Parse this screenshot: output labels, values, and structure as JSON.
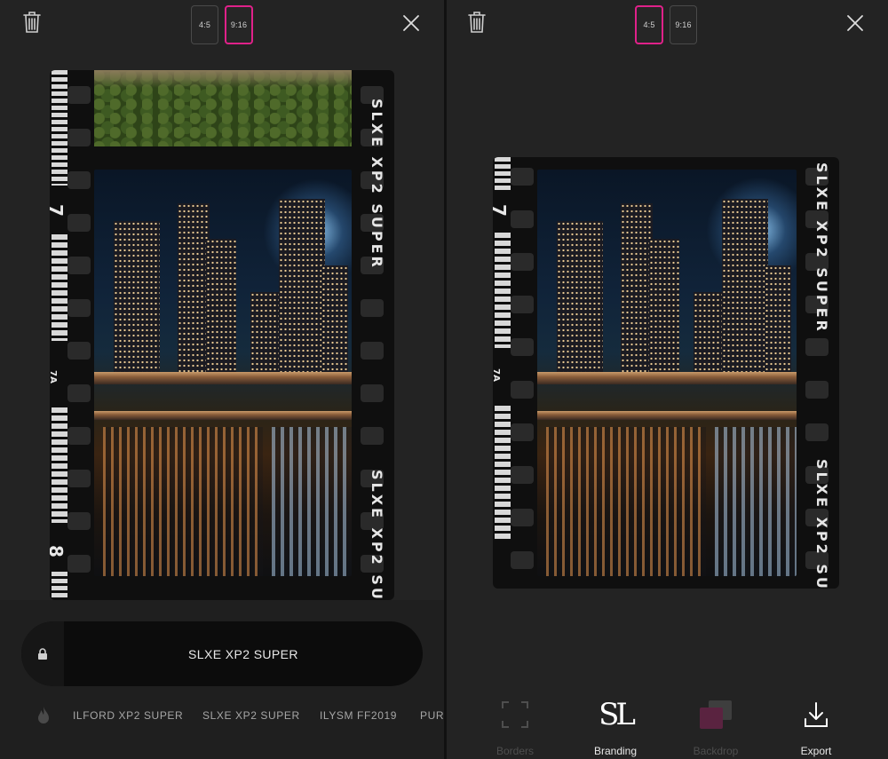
{
  "left_panel": {
    "ratio_options": [
      "4:5",
      "9:16"
    ],
    "selected_ratio": "9:16",
    "film_edge_text": "SLXE XP2 SUPER",
    "frame_numbers": [
      "7",
      "8"
    ],
    "frame_sub_label": "7A",
    "active_preset": "SLXE XP2 SUPER",
    "presets": [
      "ILFORD XP2 SUPER",
      "SLXE XP2 SUPER",
      "ILYSM FF2019",
      "PURE"
    ],
    "icons": {
      "delete": "trash-icon",
      "close": "close-icon",
      "lock": "lock-icon",
      "trending": "flame-icon"
    }
  },
  "right_panel": {
    "ratio_options": [
      "4:5",
      "9:16"
    ],
    "selected_ratio": "4:5",
    "film_edge_text": "SLXE XP2 SUPER",
    "frame_number": "7",
    "frame_sub_label": "7A",
    "branding_text": "SL",
    "tools": [
      {
        "label": "Borders",
        "icon": "borders-icon",
        "enabled": false
      },
      {
        "label": "Branding",
        "icon": "branding-icon",
        "enabled": true
      },
      {
        "label": "Backdrop",
        "icon": "backdrop-icon",
        "enabled": false
      },
      {
        "label": "Export",
        "icon": "export-icon",
        "enabled": true
      }
    ]
  },
  "colors": {
    "accent": "#e0218a",
    "background": "#232323",
    "film": "#0f0f0f"
  }
}
